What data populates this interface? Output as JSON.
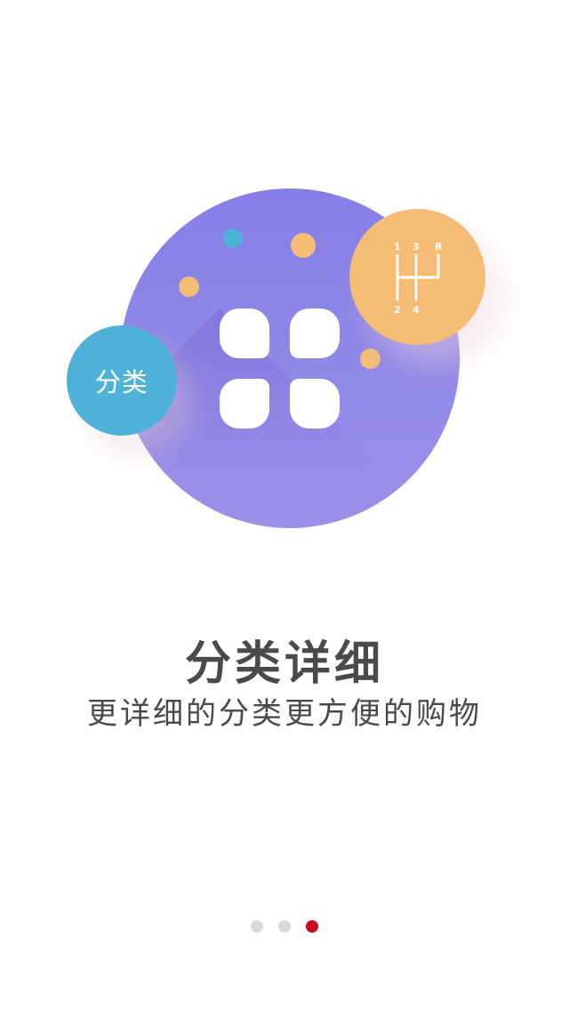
{
  "illustration": {
    "category_badge": "分类",
    "gear_labels": [
      "1",
      "3",
      "R",
      "2",
      "4"
    ]
  },
  "headline": "分类详细",
  "subline": "更详细的分类更方便的购物",
  "pager": {
    "count": 3,
    "active_index": 2
  },
  "colors": {
    "main_circle": "#8a83e7",
    "badge_blue": "#4db1d8",
    "accent_orange": "#f4bc74",
    "dot_teal": "#4cb2d6",
    "text": "#4a4a4a",
    "pager_active": "#c80a1e",
    "pager_inactive": "#d9d9d9"
  }
}
